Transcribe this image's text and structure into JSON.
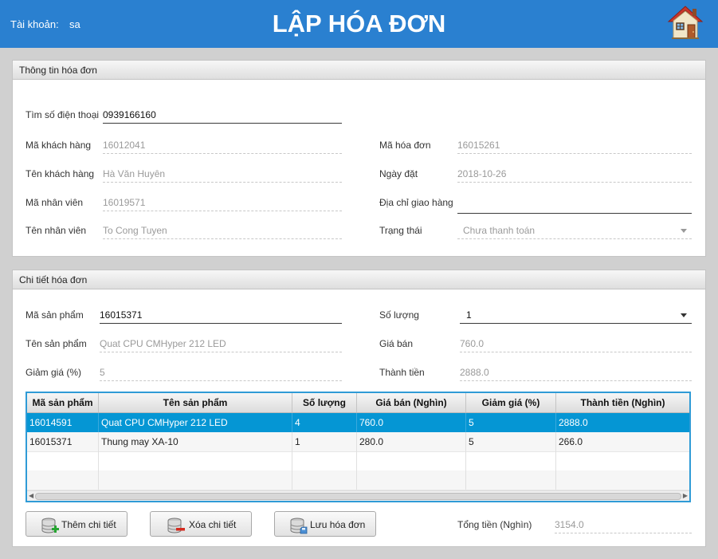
{
  "header": {
    "account_label": "Tài khoản:",
    "account_value": "sa",
    "title": "LẬP HÓA ĐƠN",
    "home_icon": "home-icon"
  },
  "invoice_info": {
    "title": "Thông tin hóa đơn",
    "phone_search": {
      "label": "Tìm số điện thoại",
      "value": "0939166160"
    },
    "customer_id": {
      "label": "Mã khách hàng",
      "value": "16012041"
    },
    "customer_name": {
      "label": "Tên khách hàng",
      "value": "Hà Văn Huyên"
    },
    "employee_id": {
      "label": "Mã nhân viên",
      "value": "16019571"
    },
    "employee_name": {
      "label": "Tên nhân viên",
      "value": "To Cong Tuyen"
    },
    "invoice_id": {
      "label": "Mã hóa đơn",
      "value": "16015261"
    },
    "order_date": {
      "label": "Ngày đặt",
      "value": "2018-10-26"
    },
    "delivery_address": {
      "label": "Địa chỉ giao hàng",
      "value": ""
    },
    "status": {
      "label": "Trạng thái",
      "value": "Chưa thanh toán"
    }
  },
  "invoice_detail": {
    "title": "Chi tiết hóa đơn",
    "product_id": {
      "label": "Mã sản phẩm",
      "value": "16015371"
    },
    "product_name": {
      "label": "Tên sản phẩm",
      "value": "Quat CPU CMHyper 212 LED"
    },
    "discount": {
      "label": "Giảm giá  (%)",
      "value": "5"
    },
    "quantity": {
      "label": "Số lượng",
      "value": "1"
    },
    "price": {
      "label": "Giá bán",
      "value": "760.0"
    },
    "subtotal": {
      "label": "Thành tiền",
      "value": "2888.0"
    }
  },
  "table": {
    "columns": [
      "Mã sản phẩm",
      "Tên sản phẩm",
      "Số lượng",
      "Giá bán (Nghìn)",
      "Giảm giá (%)",
      "Thành tiền (Nghìn)"
    ],
    "rows": [
      [
        "16014591",
        "Quat CPU CMHyper 212 LED",
        "4",
        "760.0",
        "5",
        "2888.0"
      ],
      [
        "16015371",
        "Thung may XA-10",
        "1",
        "280.0",
        "5",
        "266.0"
      ]
    ],
    "selected_row": 0
  },
  "actions": {
    "add_detail": "Thêm chi tiết",
    "delete_detail": "Xóa chi tiết",
    "save_invoice": "Lưu hóa đơn"
  },
  "total": {
    "label": "Tổng tiền (Nghìn)",
    "value": "3154.0"
  },
  "colors": {
    "header_bg": "#2a80d0",
    "selection": "#0596d4",
    "table_border": "#2f9bd6"
  }
}
